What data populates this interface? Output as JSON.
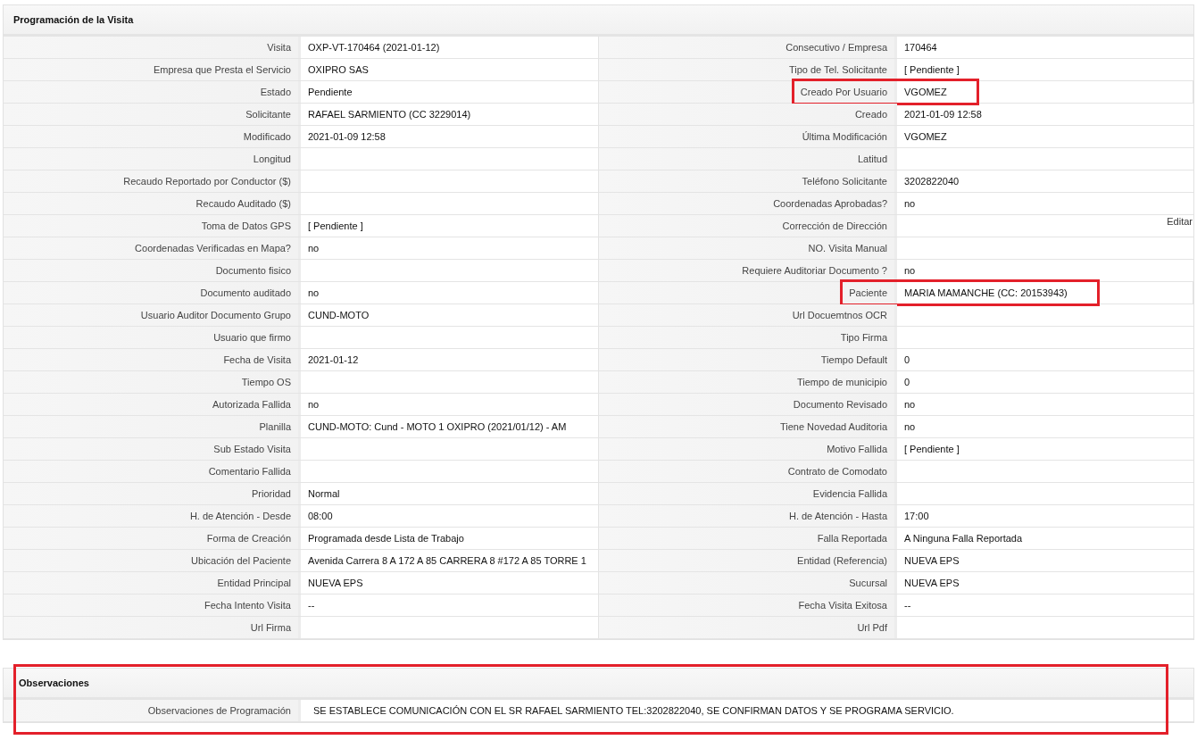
{
  "visit_section": {
    "title": "Programación de la Visita",
    "rows": [
      {
        "left": {
          "label": "Visita",
          "value": "OXP-VT-170464 (2021-01-12)",
          "highlighted": false
        },
        "right": {
          "label": "Consecutivo / Empresa",
          "value": "170464",
          "highlighted": false
        }
      },
      {
        "left": {
          "label": "Empresa que Presta el Servicio",
          "value": "OXIPRO SAS",
          "highlighted": false
        },
        "right": {
          "label": "Tipo de Tel. Solicitante",
          "value": "[ Pendiente ]",
          "highlighted": false
        }
      },
      {
        "left": {
          "label": "Estado",
          "value": "Pendiente",
          "highlighted": false
        },
        "right": {
          "label": "Creado Por Usuario",
          "value": "VGOMEZ",
          "highlighted": true
        }
      },
      {
        "left": {
          "label": "Solicitante",
          "value": "RAFAEL SARMIENTO (CC 3229014)",
          "highlighted": false
        },
        "right": {
          "label": "Creado",
          "value": "2021-01-09 12:58",
          "highlighted": false
        }
      },
      {
        "left": {
          "label": "Modificado",
          "value": "2021-01-09 12:58",
          "highlighted": false
        },
        "right": {
          "label": "Última Modificación",
          "value": "VGOMEZ",
          "highlighted": false
        }
      },
      {
        "left": {
          "label": "Longitud",
          "highlighted": false
        },
        "right": {
          "label": "Latitud",
          "highlighted": false
        }
      },
      {
        "left": {
          "label": "Recaudo Reportado por Conductor ($)",
          "highlighted": false
        },
        "right": {
          "label": "Teléfono Solicitante",
          "value": "3202822040",
          "highlighted": false
        }
      },
      {
        "left": {
          "label": "Recaudo Auditado ($)",
          "highlighted": false
        },
        "right": {
          "label": "Coordenadas Aprobadas?",
          "value": "no",
          "highlighted": false
        }
      },
      {
        "left": {
          "label": "Toma de Datos GPS",
          "value": "[ Pendiente ]",
          "highlighted": false
        },
        "right": {
          "label": "Corrección de Dirección",
          "link": "Editar",
          "highlighted": false
        }
      },
      {
        "left": {
          "label": "Coordenadas Verificadas en Mapa?",
          "value": "no",
          "highlighted": false
        },
        "right": {
          "label": "NO. Visita Manual",
          "highlighted": false
        }
      },
      {
        "left": {
          "label": "Documento fisico",
          "highlighted": false
        },
        "right": {
          "label": "Requiere Auditoriar Documento ?",
          "value": "no",
          "highlighted": false
        }
      },
      {
        "left": {
          "label": "Documento auditado",
          "value": "no",
          "highlighted": false
        },
        "right": {
          "label": "Paciente",
          "value": "MARIA MAMANCHE (CC: 20153943)",
          "highlighted": true
        }
      },
      {
        "left": {
          "label": "Usuario Auditor Documento Grupo",
          "value": "CUND-MOTO",
          "highlighted": false
        },
        "right": {
          "label": "Url Docuemtnos OCR",
          "highlighted": false
        }
      },
      {
        "left": {
          "label": "Usuario que firmo",
          "highlighted": false
        },
        "right": {
          "label": "Tipo Firma",
          "highlighted": false
        }
      },
      {
        "left": {
          "label": "Fecha de Visita",
          "value": "2021-01-12",
          "highlighted": false
        },
        "right": {
          "label": "Tiempo Default",
          "value": "0",
          "highlighted": false
        }
      },
      {
        "left": {
          "label": "Tiempo OS",
          "highlighted": false
        },
        "right": {
          "label": "Tiempo de municipio",
          "value": "0",
          "highlighted": false
        }
      },
      {
        "left": {
          "label": "Autorizada Fallida",
          "value": "no",
          "highlighted": false
        },
        "right": {
          "label": "Documento Revisado",
          "value": "no",
          "highlighted": false
        }
      },
      {
        "left": {
          "label": "Planilla",
          "value": "CUND-MOTO: Cund - MOTO 1 OXIPRO (2021/01/12) - AM",
          "highlighted": false
        },
        "right": {
          "label": "Tiene Novedad Auditoria",
          "value": "no",
          "highlighted": false
        }
      },
      {
        "left": {
          "label": "Sub Estado Visita",
          "highlighted": false
        },
        "right": {
          "label": "Motivo Fallida",
          "value": "[ Pendiente ]",
          "highlighted": false
        }
      },
      {
        "left": {
          "label": "Comentario Fallida",
          "highlighted": false
        },
        "right": {
          "label": "Contrato de Comodato",
          "highlighted": false
        }
      },
      {
        "left": {
          "label": "Prioridad",
          "value": "Normal",
          "highlighted": false
        },
        "right": {
          "label": "Evidencia Fallida",
          "highlighted": false
        }
      },
      {
        "left": {
          "label": "H. de Atención - Desde",
          "value": "08:00",
          "highlighted": false
        },
        "right": {
          "label": "H. de Atención - Hasta",
          "value": "17:00",
          "highlighted": false
        }
      },
      {
        "left": {
          "label": "Forma de Creación",
          "value": "Programada desde Lista de Trabajo",
          "highlighted": false
        },
        "right": {
          "label": "Falla Reportada",
          "value": "A Ninguna Falla Reportada",
          "highlighted": false
        }
      },
      {
        "left": {
          "label": "Ubicación del Paciente",
          "value": "Avenida Carrera 8 A 172 A 85 CARRERA 8 #172 A 85 TORRE 1",
          "highlighted": false
        },
        "right": {
          "label": "Entidad (Referencia)",
          "value": "NUEVA EPS",
          "highlighted": false
        }
      },
      {
        "left": {
          "label": "Entidad Principal",
          "value": "NUEVA EPS",
          "highlighted": false
        },
        "right": {
          "label": "Sucursal",
          "value": "NUEVA EPS",
          "highlighted": false
        }
      },
      {
        "left": {
          "label": "Fecha Intento Visita",
          "value": "--",
          "highlighted": false
        },
        "right": {
          "label": "Fecha Visita Exitosa",
          "value": "--",
          "highlighted": false
        }
      },
      {
        "left": {
          "label": "Url Firma",
          "highlighted": false
        },
        "right": {
          "label": "Url Pdf",
          "highlighted": false
        }
      }
    ]
  },
  "observations_section": {
    "title": "Observaciones",
    "highlighted": true,
    "rows": [
      {
        "label": "Observaciones de Programación",
        "value": "SE ESTABLECE COMUNICACIÓN CON EL SR RAFAEL SARMIENTO TEL:3202822040, SE CONFIRMAN DATOS Y SE PROGRAMA SERVICIO."
      }
    ]
  }
}
